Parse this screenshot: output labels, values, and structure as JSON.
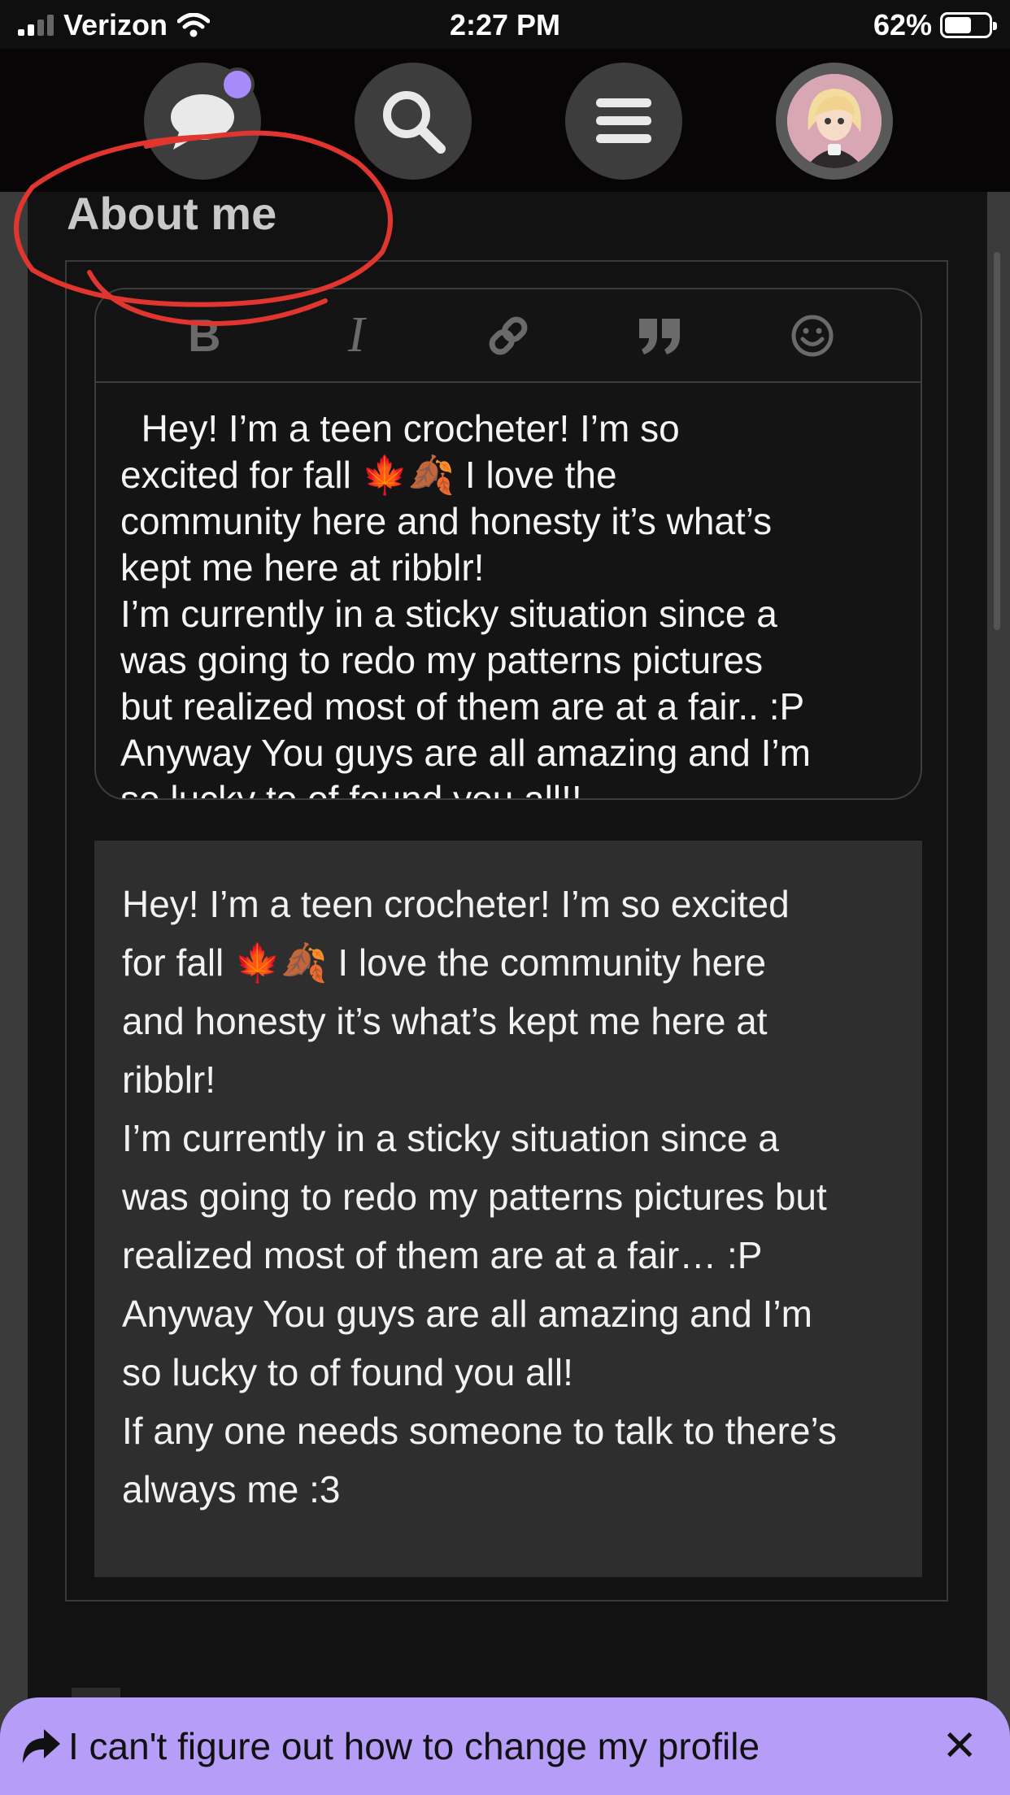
{
  "status_bar": {
    "carrier": "Verizon",
    "time": "2:27 PM",
    "battery_percent": "62%",
    "battery_level": 0.62
  },
  "nav": {
    "icons": [
      "chat-bubble-icon",
      "search-icon",
      "menu-icon",
      "profile-avatar"
    ],
    "notification_color": "#a78bfa"
  },
  "section": {
    "title": "About me"
  },
  "editor": {
    "toolbar": [
      "bold-icon",
      "italic-icon",
      "link-icon",
      "quote-icon",
      "emoji-icon"
    ],
    "bold_glyph": "B",
    "italic_glyph": "I",
    "text": "  Hey! I’m a teen crocheter! I’m so\nexcited for fall 🍁🍂 I love the\ncommunity here and honesty it’s what’s\nkept me here at ribblr!\nI’m currently in a sticky situation since a\nwas going to redo my patterns pictures\nbut realized most of them are at a fair.. :P\nAnyway You guys are all amazing and I’m\nso lucky to of found you all!!"
  },
  "preview": {
    "text": "Hey! I’m a teen crocheter! I’m so excited\nfor fall 🍁🍂 I love the community here\nand honesty it’s what’s kept me here at\nribblr!\nI’m currently in a sticky situation since a\nwas going to redo my patterns pictures but\nrealized most of them are at a fair… :P\nAnyway You guys are all amazing and I’m\nso lucky to of found you all!\nIf any one needs someone to talk to there’s\nalways me :3"
  },
  "toast": {
    "text": "I can't figure out how to change my profile",
    "close_glyph": "✕",
    "background": "#b69df7"
  },
  "annotation": {
    "color": "#e0362f"
  }
}
